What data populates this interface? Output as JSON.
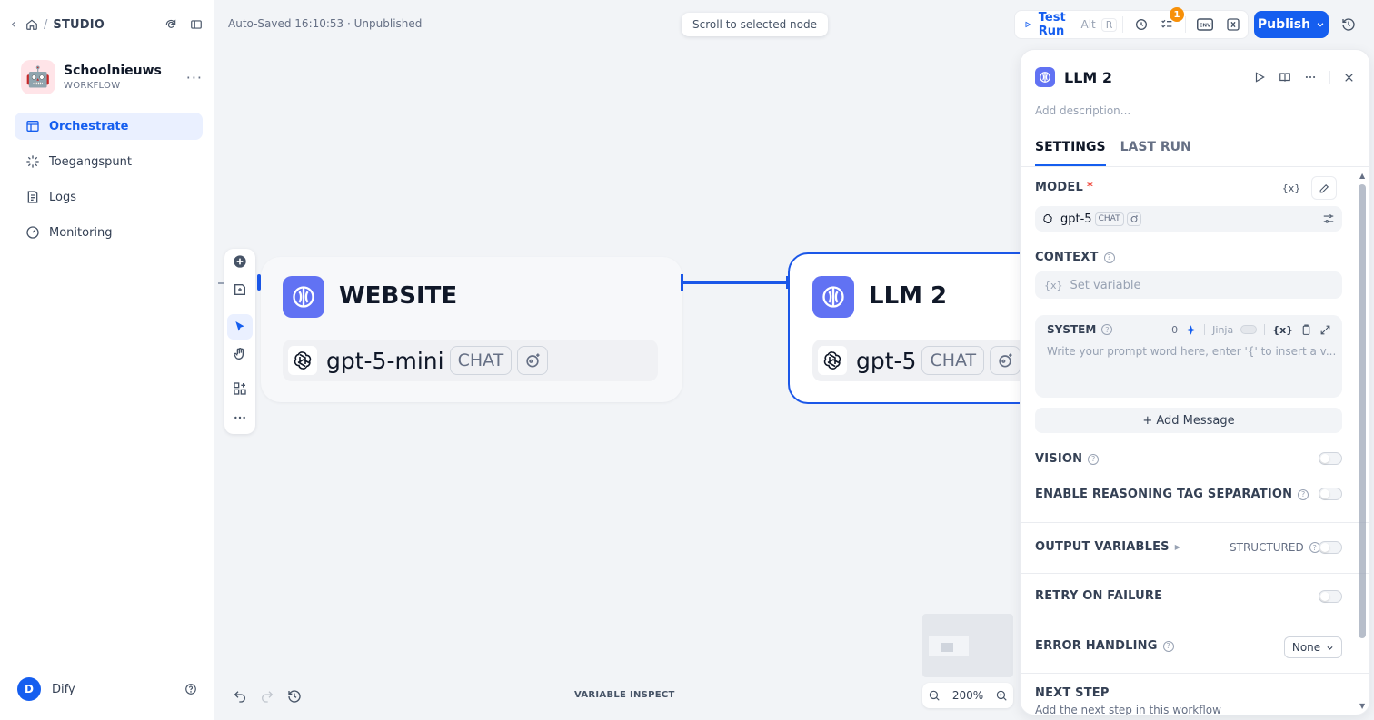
{
  "sidebar": {
    "breadcrumb": "STUDIO",
    "app": {
      "name": "Schoolnieuws",
      "type": "WORKFLOW",
      "emoji": "🤖"
    },
    "nav": [
      {
        "label": "Orchestrate",
        "active": true
      },
      {
        "label": "Toegangspunt",
        "active": false
      },
      {
        "label": "Logs",
        "active": false
      },
      {
        "label": "Monitoring",
        "active": false
      }
    ],
    "user": {
      "initial": "D",
      "name": "Dify"
    }
  },
  "topbar": {
    "autosave": "Auto-Saved 16:10:53 · Unpublished",
    "scroll_tip": "Scroll to selected node",
    "test_run": "Test Run",
    "shortcut_mod": "Alt",
    "shortcut_key": "R",
    "checklist_count": "1",
    "env_label": "ENV",
    "publish": "Publish"
  },
  "canvas": {
    "nodes": [
      {
        "title": "WEBSITE",
        "model": "gpt-5-mini",
        "tag": "CHAT"
      },
      {
        "title": "LLM 2",
        "model": "gpt-5",
        "tag": "CHAT"
      }
    ],
    "variable_inspect": "VARIABLE INSPECT",
    "zoom": "200%"
  },
  "panel": {
    "title": "LLM 2",
    "description_placeholder": "Add description...",
    "tabs": [
      "SETTINGS",
      "LAST RUN"
    ],
    "model_label": "MODEL",
    "required_mark": "*",
    "var_btn": "{x}",
    "model_value": "gpt-5",
    "model_tag": "CHAT",
    "context_label": "CONTEXT",
    "context_placeholder": "Set variable",
    "context_prefix": "{x}",
    "system_label": "SYSTEM",
    "system_count": "0",
    "jinja": "Jinja",
    "system_placeholder": "Write your prompt word here, enter '{' to insert a v...",
    "add_message": "+ Add Message",
    "vision_label": "VISION",
    "reasoning_label": "ENABLE REASONING TAG SEPARATION",
    "output_label": "OUTPUT VARIABLES",
    "structured_label": "STRUCTURED",
    "retry_label": "RETRY ON FAILURE",
    "error_label": "ERROR HANDLING",
    "error_value": "None",
    "next_label": "NEXT STEP",
    "next_desc": "Add the next step in this workflow"
  },
  "colors": {
    "accent": "#155eef",
    "node_icon": "#6172f3",
    "badge": "#f79009"
  }
}
